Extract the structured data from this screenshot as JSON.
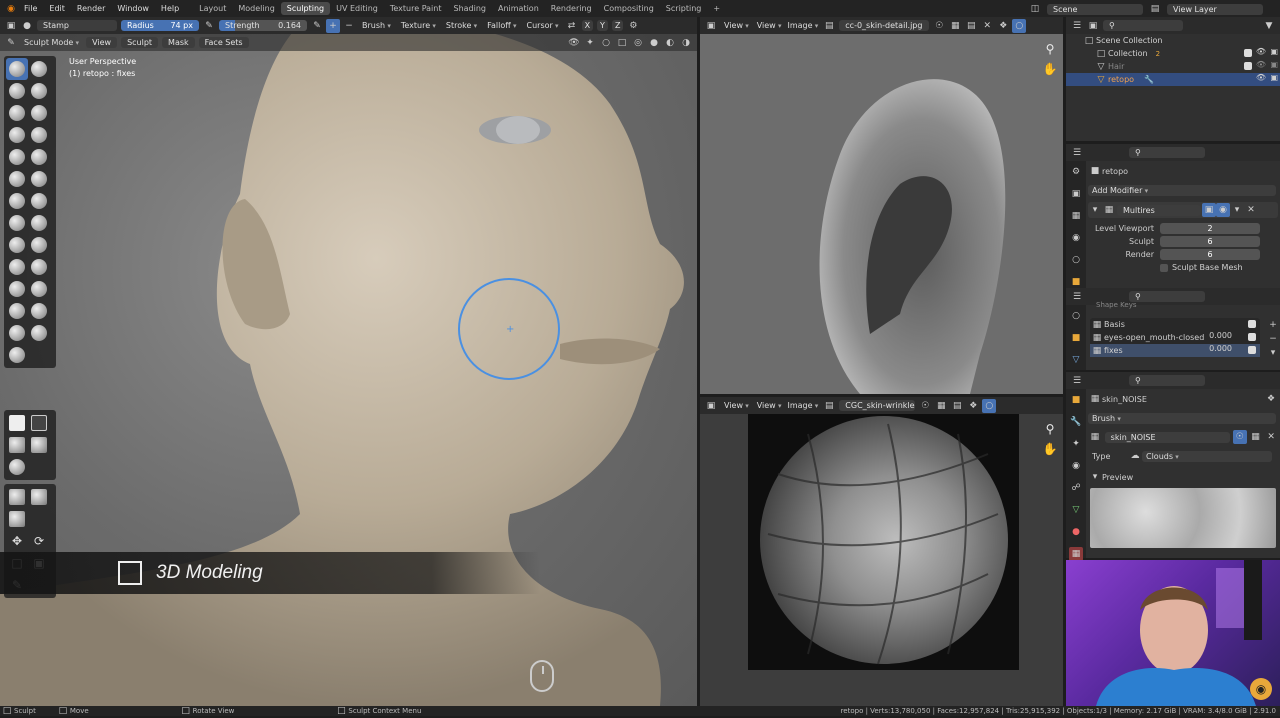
{
  "menubar": {
    "items": [
      "File",
      "Edit",
      "Render",
      "Window",
      "Help"
    ]
  },
  "workspaces": [
    "Layout",
    "Modeling",
    "Sculpting",
    "UV Editing",
    "Texture Paint",
    "Shading",
    "Animation",
    "Rendering",
    "Compositing",
    "Scripting"
  ],
  "active_workspace": "Sculpting",
  "scene": "Scene",
  "view_layer": "View Layer",
  "tool_header": {
    "brush_name": "Stamp",
    "radius_label": "Radius",
    "radius_value": "74 px",
    "strength_label": "Strength",
    "strength_value": "0.164",
    "axes": [
      "X",
      "Y",
      "Z"
    ],
    "menus": [
      "Brush",
      "Texture",
      "Stroke",
      "Falloff",
      "Cursor"
    ]
  },
  "viewport_header": {
    "mode": "Sculpt Mode",
    "menus": [
      "View",
      "Sculpt",
      "Mask",
      "Face Sets"
    ]
  },
  "viewport": {
    "perspective": "User Perspective",
    "object": "(1) retopo : fixes"
  },
  "banner": {
    "text": "3D Modeling"
  },
  "image_editor_top": {
    "menus": [
      "View",
      "View",
      "Image"
    ],
    "image_name": "cc-0_skin-detail.jpg"
  },
  "image_editor_bottom": {
    "menus": [
      "View",
      "View",
      "Image"
    ],
    "image_name": "CGC_skin-wrinkles-b..."
  },
  "outliner": {
    "root": "Scene Collection",
    "items": [
      {
        "name": "Collection",
        "badge": "2"
      },
      {
        "name": "Hair"
      },
      {
        "name": "retopo"
      }
    ]
  },
  "modifier_panel": {
    "object": "retopo",
    "add_modifier": "Add Modifier",
    "modifier_name": "Multires",
    "rows": [
      {
        "label": "Level Viewport",
        "value": "2"
      },
      {
        "label": "Sculpt",
        "value": "6"
      },
      {
        "label": "Render",
        "value": "6"
      }
    ],
    "sculpt_base_mesh": "Sculpt Base Mesh"
  },
  "shape_keys": {
    "title": "Shape Keys",
    "items": [
      {
        "name": "Basis",
        "value": ""
      },
      {
        "name": "eyes-open_mouth-closed",
        "value": "0.000"
      },
      {
        "name": "fixes",
        "value": "0.000"
      }
    ]
  },
  "texture_panel": {
    "name": "skin_NOISE",
    "context": "Brush",
    "texture_field": "skin_NOISE",
    "type_label": "Type",
    "type_value": "Clouds",
    "preview_label": "Preview"
  },
  "status_bar": {
    "left": [
      "Sculpt",
      "Move",
      "Rotate View",
      "Sculpt Context Menu"
    ],
    "right": "retopo | Verts:13,780,050 | Faces:12,957,824 | Tris:25,915,392 | Objects:1/3 | Memory: 2.17 GiB | VRAM: 3.4/8.0 GiB | 2.91.0"
  },
  "colors": {
    "accent": "#4772b3",
    "active_highlight": "#334d80",
    "brush_ring": "#4a90e2"
  }
}
